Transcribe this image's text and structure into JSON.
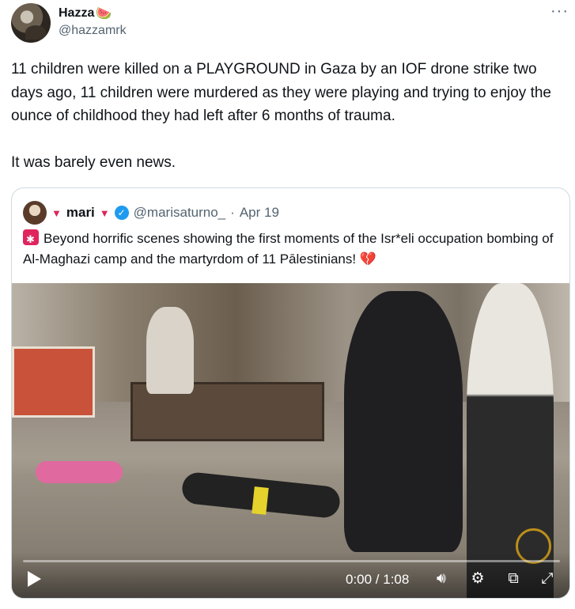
{
  "author": {
    "display_name": "Hazza",
    "name_emoji": "🍉",
    "handle": "@hazzamrk"
  },
  "more_label": "···",
  "tweet": {
    "paragraph1": "11 children were killed on a PLAYGROUND in Gaza by an IOF drone strike two days ago, 11 children were murdered as they were playing and trying to enjoy the ounce of childhood they had left after 6 months of trauma.",
    "paragraph2": "It was barely even news."
  },
  "quote": {
    "name": "mari",
    "name_prefix_symbol": "▼",
    "name_suffix_symbol": "▼",
    "verified_mark": "✓",
    "handle": "@marisaturno_",
    "separator": "·",
    "date": "Apr 19",
    "text": "Beyond horrific scenes showing the first moments of the Isr*eli occupation bombing of Al-Maghazi camp and the martyrdom of 11 Pālestinians!",
    "text_emoji": "💔",
    "video": {
      "time": "0:00 / 1:08",
      "progress": 0,
      "icons": [
        "play-icon",
        "volume-icon",
        "settings-icon",
        "picture-in-picture-icon",
        "fullscreen-icon"
      ]
    }
  },
  "colors": {
    "text": "#0f1419",
    "secondary": "#536471",
    "border": "#cfd9de",
    "verified": "#1d9bf0",
    "accent_red": "#e0245e"
  }
}
